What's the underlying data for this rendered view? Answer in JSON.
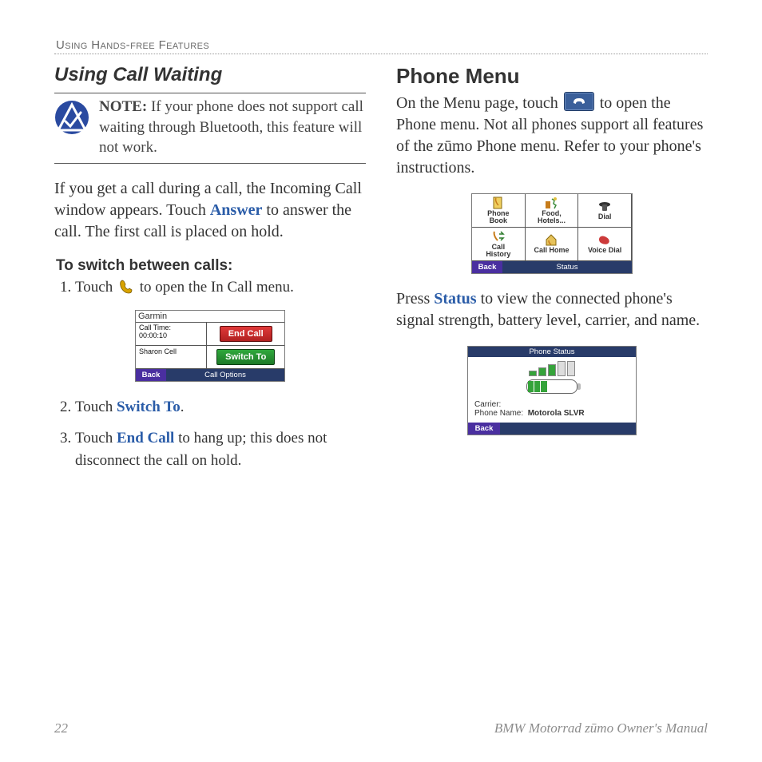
{
  "runningHead": "Using Hands-free Features",
  "left": {
    "heading": "Using Call Waiting",
    "noteLabel": "NOTE:",
    "noteBody": " If your phone does not support call waiting through Bluetooth, this feature will not work.",
    "para1a": "If you get a call during a call, the Incoming Call window appears. Touch ",
    "para1_kw": "Answer",
    "para1b": " to answer the call. The first call is placed on hold.",
    "subHead": "To switch between calls:",
    "step1a": "Touch ",
    "step1b": " to open the In Call menu.",
    "step2a": "Touch ",
    "step2_kw": "Switch To",
    "step2b": ".",
    "step3a": "Touch ",
    "step3_kw": "End Call",
    "step3b": " to hang up; this does not disconnect the call on hold."
  },
  "right": {
    "heading": "Phone Menu",
    "para1a": "On the Menu page, touch ",
    "para1b": " to open the Phone menu. Not all phones support all features of the zūmo Phone menu. Refer to your phone's instructions.",
    "para2a": "Press ",
    "para2_kw": "Status",
    "para2b": " to view the connected phone's signal strength, battery level, carrier, and name."
  },
  "scrInCall": {
    "title": "Garmin",
    "callTimeLabel": "Call Time:",
    "callTime": "00:00:10",
    "caller": "Sharon Cell",
    "endCall": "End Call",
    "switchTo": "Switch To",
    "back": "Back",
    "callOptions": "Call Options"
  },
  "scrMenu": {
    "items": [
      "Phone\nBook",
      "Food,\nHotels...",
      "Dial",
      "Call\nHistory",
      "Call Home",
      "Voice Dial"
    ],
    "back": "Back",
    "status": "Status"
  },
  "scrStatus": {
    "title": "Phone Status",
    "carrierLabel": "Carrier:",
    "carrier": "",
    "nameLabel": "Phone Name:",
    "name": "Motorola SLVR",
    "back": "Back"
  },
  "footer": {
    "page": "22",
    "manual": "BMW Motorrad zūmo Owner's Manual"
  }
}
